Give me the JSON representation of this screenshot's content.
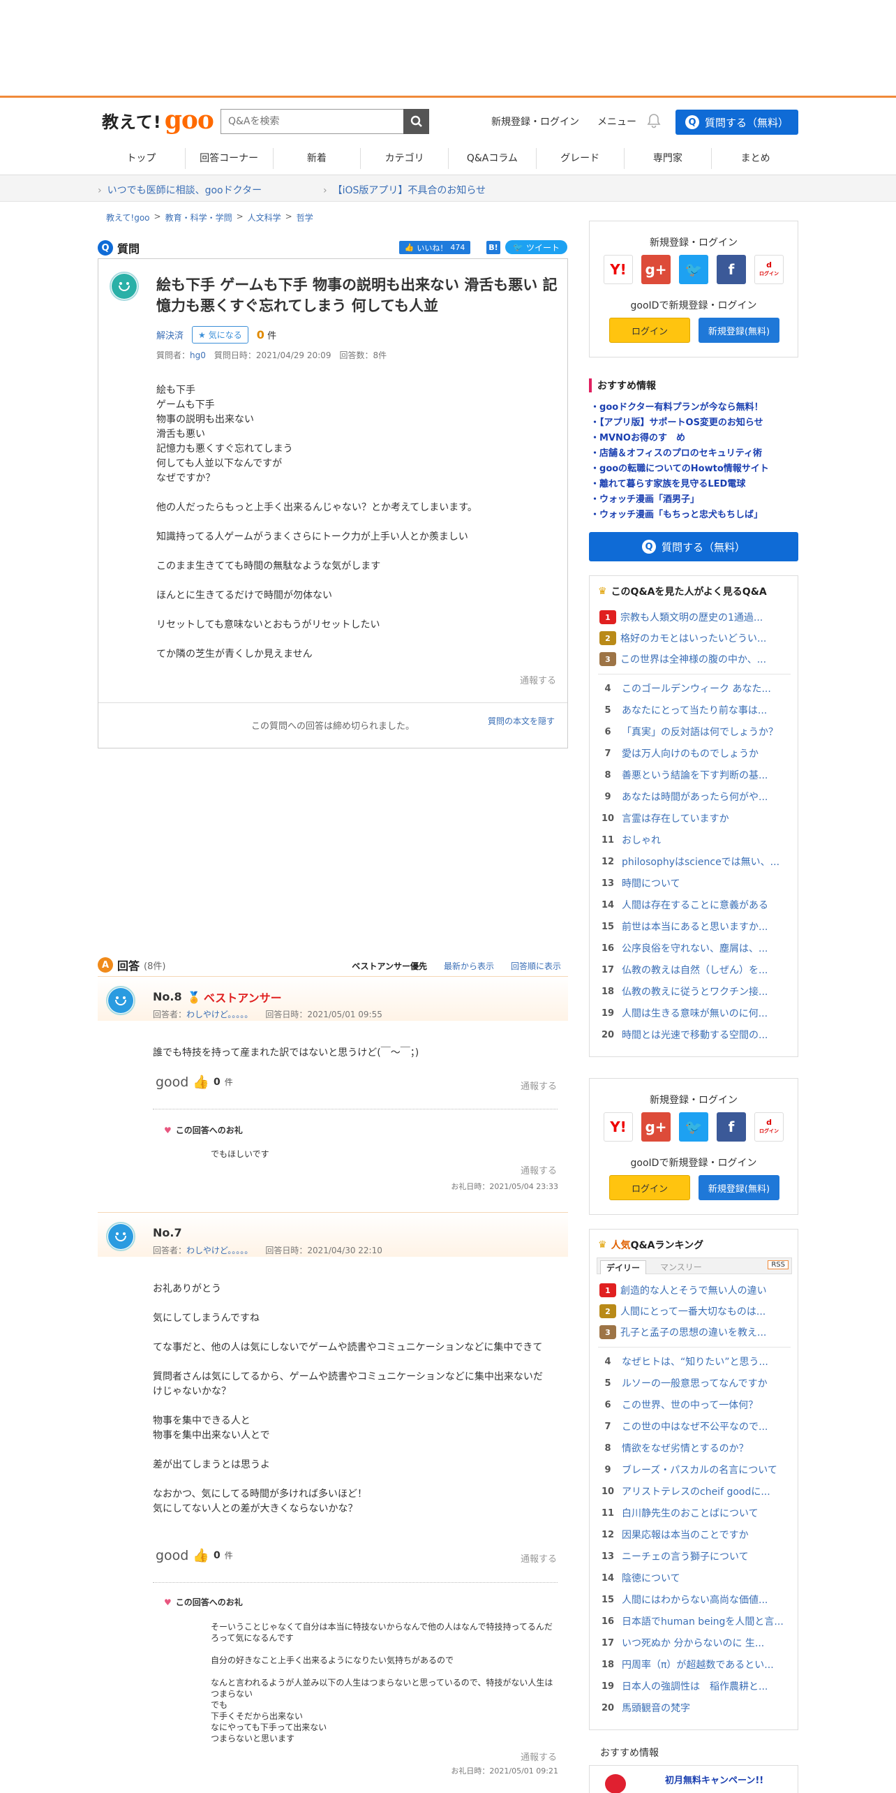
{
  "header": {
    "logo_text": "教えて!",
    "logo_brand": "goo",
    "search_placeholder": "Q&Aを検索",
    "signup_login": "新規登録・ログイン",
    "menu": "メニュー",
    "ask_button": "質問する（無料）"
  },
  "nav": [
    "トップ",
    "回答コーナー",
    "新着",
    "カテゴリ",
    "Q&Aコラム",
    "グレード",
    "専門家",
    "まとめ"
  ],
  "notices": [
    "いつでも医師に相談、gooドクター",
    "【iOS版アプリ】不具合のお知らせ"
  ],
  "breadcrumb": [
    "教えて!goo",
    "教育・科学・学問",
    "人文科学",
    "哲学"
  ],
  "question": {
    "section_label": "質問",
    "like_label": "いいね！",
    "like_count": "474",
    "tweet_label": "ツイート",
    "title": "絵も下手 ゲームも下手 物事の説明も出来ない 滑舌も悪い 記憶力も悪くすぐ忘れてしまう 何しても人並",
    "status": "解決済",
    "watch_label": "気になる",
    "watch_count": "0",
    "watch_unit": "件",
    "meta_asker_label": "質問者：",
    "asker": "hg0",
    "meta_rest": "質問日時：2021/04/29 20:09　回答数：8件",
    "body": "絵も下手\nゲームも下手\n物事の説明も出来ない\n滑舌も悪い\n記憶力も悪くすぐ忘れてしまう\n何しても人並以下なんですが\nなぜですか？\n\n他の人だったらもっと上手く出来るんじゃない？とか考えてしまいます。\n\n知識持ってる人ゲームがうまくさらにトーク力が上手い人とか羨ましい\n\nこのまま生きてても時間の無駄なような気がします\n\nほんとに生きてるだけで時間が勿体ない\n\nリセットしても意味ないとおもうがリセットしたい\n\nてか隣の芝生が青くしか見えません",
    "report": "通報する",
    "closed_note": "この質問への回答は締め切られました。",
    "hide_body": "質問の本文を隠す"
  },
  "answers_header": {
    "label": "回答",
    "count": "(8件)",
    "sort": [
      "ベストアンサー優先",
      "最新から表示",
      "回答順に表示"
    ]
  },
  "answers": [
    {
      "no": "No.8",
      "best": "ベストアンサー",
      "responder_label": "回答者：",
      "responder": "わしやけど。。。。。",
      "date": "回答日時：2021/05/01 09:55",
      "body": "誰でも特技を持って産まれた訳ではないと思うけど(￣～￣；)",
      "good": "good",
      "good_count": "0",
      "good_unit": "件",
      "report": "通報する",
      "thanks_label": "この回答へのお礼",
      "thanks": "でもほしいです",
      "thanks_date": "お礼日時：2021/05/04 23:33"
    },
    {
      "no": "No.7",
      "responder_label": "回答者：",
      "responder": "わしやけど。。。。。",
      "date": "回答日時：2021/04/30 22:10",
      "body": "お礼ありがとう\n\n気にしてしまうんですね\n\nてな事だと、他の人は気にしないでゲームや読書やコミュニケーションなどに集中できて\n\n質問者さんは気にしてるから、ゲームや読書やコミュニケーションなどに集中出来ないだけじゃないかな？\n\n物事を集中できる人と\n物事を集中出来ない人とで\n\n差が出てしまうとは思うよ\n\nなおかつ、気にしてる時間が多ければ多いほど！\n気にしてない人との差が大きくならないかな？",
      "good": "good",
      "good_count": "0",
      "good_unit": "件",
      "report": "通報する",
      "thanks_label": "この回答へのお礼",
      "thanks": "そーいうことじゃなくて自分は本当に特技ないからなんで他の人はなんで特技持ってるんだろって気になるんです\n\n自分の好きなこと上手く出来るようになりたい気持ちがあるので\n\nなんと言われるようが人並み以下の人生はつまらないと思っているので、特技がない人生はつまらない\nでも\n下手くそだから出来ない\nなにやっても下手って出来ない\nつまらないと思います",
      "thanks_date": "お礼日時：2021/05/01 09:21"
    }
  ],
  "sidebar": {
    "login_title": "新規登録・ログイン",
    "login_sub": "gooIDで新規登録・ログイン",
    "login_btn": "ログイン",
    "register_btn": "新規登録(無料)",
    "sns": [
      "Y!",
      "g+",
      "twitter-icon",
      "f",
      "d ログイン"
    ],
    "recommend_title": "おすすめ情報",
    "recommend": [
      "gooドクター有料プランが今なら無料！",
      "【アプリ版】サポートOS変更のお知らせ",
      "MVNOお得のす　め",
      "店舗＆オフィスのプロのセキュリティ術",
      "gooの転職についてのHowto情報サイト",
      "離れて暮らす家族を見守るLED電球",
      "ウォッチ漫画「酒男子」",
      "ウォッチ漫画「もちっと忠犬もちしば」"
    ],
    "ask_button": "質問する（無料）",
    "related_title": "このQ&Aを見た人がよく見るQ&A",
    "related": [
      "宗教も人類文明の歴史の1通過...",
      "格好のカモとはいったいどうい...",
      "この世界は全神様の腹の中か、...",
      "このゴールデンウィーク あなた...",
      "あなたにとって当たり前な事は...",
      "「真実」の反対語は何でしょうか？",
      "愛は万人向けのものでしょうか",
      "善悪という結論を下す判断の基...",
      "あなたは時間があったら何がや...",
      "言霊は存在していますか",
      "おしゃれ",
      "philosophyはscienceでは無い、...",
      "時間について",
      "人間は存在することに意義がある",
      "前世は本当にあると思いますか...",
      "公序良俗を守れない、塵屑は、...",
      "仏教の教えは自然（しぜん）を...",
      "仏教の教えに従うとワクチン接...",
      "人間は生きる意味が無いのに何...",
      "時間とは光速で移動する空間の..."
    ],
    "ranking_title_a": "人気",
    "ranking_title_b": "Q&Aランキング",
    "ranking_tabs": [
      "デイリー",
      "マンスリー"
    ],
    "rss": "RSS",
    "ranking": [
      "創造的な人とそうで無い人の違い",
      "人間にとって一番大切なものは...",
      "孔子と孟子の思想の違いを教え...",
      "なぜヒトは、“知りたい”と思う...",
      "ルソーの一般意思ってなんですか",
      "この世界、世の中って一体何？",
      "この世の中はなぜ不公平なので...",
      "情欲をなぜ劣情とするのか？",
      "ブレーズ・パスカルの名言について",
      "アリストテレスのcheif goodに...",
      "白川静先生のおことばについて",
      "因果応報は本当のことですか",
      "ニーチェの言う獅子について",
      "陰徳について",
      "人間にはわからない高尚な価値...",
      "日本語でhuman beingを人間と言...",
      "いつ死ぬか 分からないのに 生...",
      "円周率（π）が超越数であるとい...",
      "日本人の強調性は　稲作農耕と...",
      "馬頭観音の梵字"
    ],
    "recommend2_title": "おすすめ情報",
    "campaign": "初月無料キャンペーン!!"
  }
}
